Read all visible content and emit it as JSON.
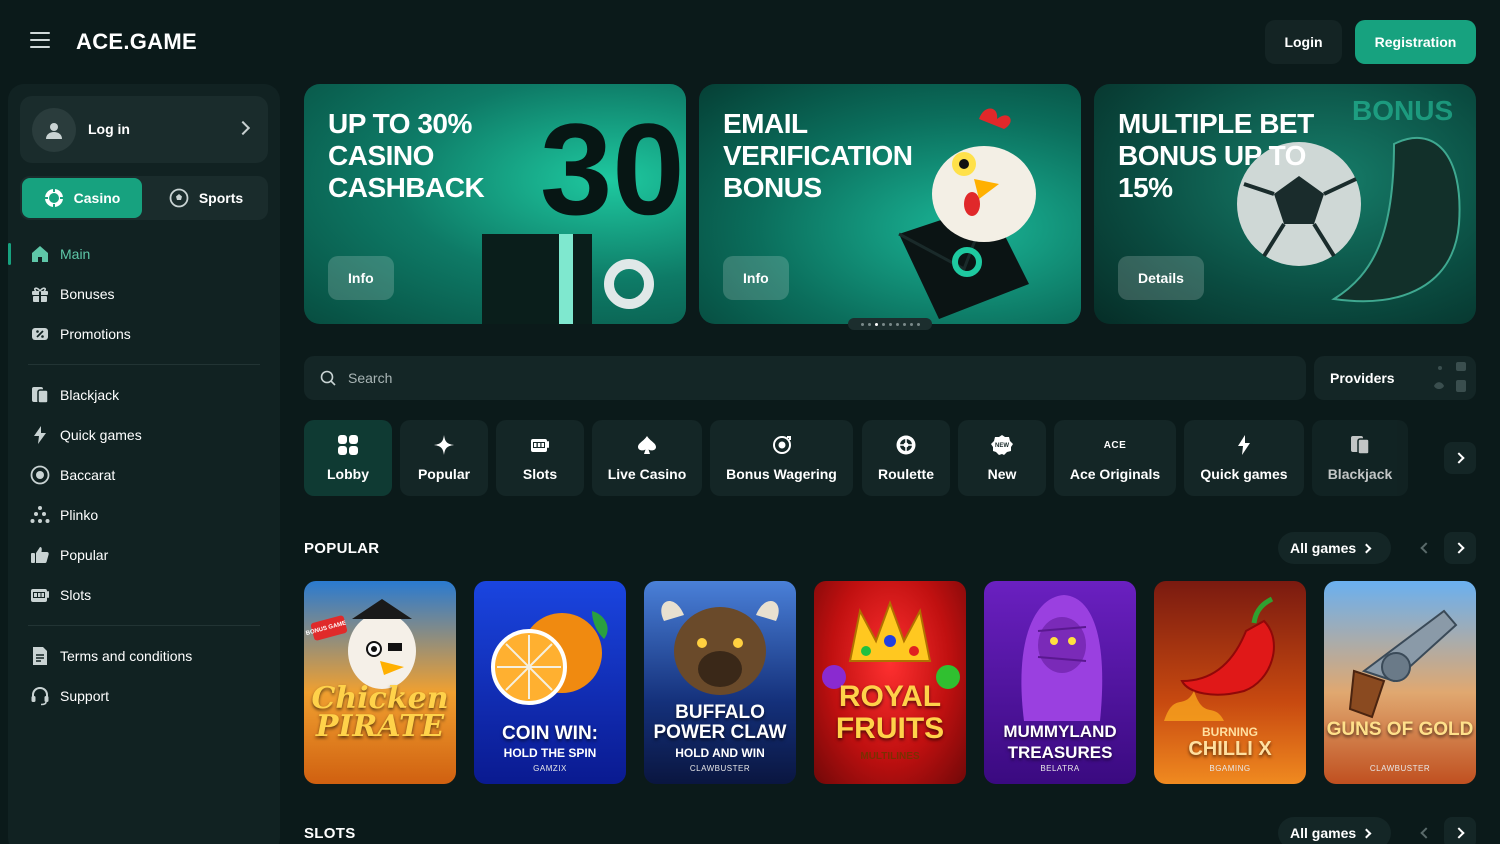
{
  "header": {
    "logo": "ACE.GAME",
    "login_label": "Login",
    "registration_label": "Registration"
  },
  "sidebar": {
    "login_card_label": "Log in",
    "switch": {
      "casino": "Casino",
      "sports": "Sports"
    },
    "main_nav": [
      {
        "label": "Main",
        "icon": "home-icon",
        "active": true
      },
      {
        "label": "Bonuses",
        "icon": "gift-icon"
      },
      {
        "label": "Promotions",
        "icon": "ticket-icon"
      }
    ],
    "game_nav": [
      {
        "label": "Blackjack",
        "icon": "cards-icon"
      },
      {
        "label": "Quick games",
        "icon": "lightning-icon"
      },
      {
        "label": "Baccarat",
        "icon": "chip-icon"
      },
      {
        "label": "Plinko",
        "icon": "plinko-icon"
      },
      {
        "label": "Popular",
        "icon": "thumbs-up-icon"
      },
      {
        "label": "Slots",
        "icon": "slot-machine-icon"
      }
    ],
    "footer_nav": [
      {
        "label": "Terms and conditions",
        "icon": "document-icon"
      },
      {
        "label": "Support",
        "icon": "headset-icon"
      }
    ]
  },
  "banners": [
    {
      "title": "UP TO 30% CASINO CASHBACK",
      "button": "Info",
      "deco": "30"
    },
    {
      "title": "EMAIL VERIFICATION BONUS",
      "button": "Info"
    },
    {
      "title": "MULTIPLE BET BONUS UP TO 15%",
      "button": "Details",
      "deco": "BONUS"
    }
  ],
  "carousel": {
    "count": 9,
    "active": 2
  },
  "search": {
    "placeholder": "Search"
  },
  "providers_label": "Providers",
  "categories": [
    {
      "label": "Lobby",
      "icon": "grid-icon",
      "active": true
    },
    {
      "label": "Popular",
      "icon": "sparkle-icon"
    },
    {
      "label": "Slots",
      "icon": "slot-machine-icon"
    },
    {
      "label": "Live Casino",
      "icon": "spade-icon"
    },
    {
      "label": "Bonus Wagering",
      "icon": "wager-icon"
    },
    {
      "label": "Roulette",
      "icon": "roulette-icon"
    },
    {
      "label": "New",
      "icon": "new-badge-icon",
      "icon_text": "NEW"
    },
    {
      "label": "Ace Originals",
      "icon": "ace-icon",
      "icon_text": "ACE"
    },
    {
      "label": "Quick games",
      "icon": "lightning-icon"
    },
    {
      "label": "Blackjack",
      "icon": "cards-icon"
    }
  ],
  "sections": [
    {
      "title": "POPULAR",
      "all_label": "All games"
    },
    {
      "title": "SLOTS",
      "all_label": "All games"
    }
  ],
  "games": [
    {
      "title": "Chicken PIRATE",
      "badge": "BONUS GAME",
      "colors": [
        "#1a5fb0",
        "#f0a030"
      ]
    },
    {
      "title": "COIN WIN:",
      "subtitle": "HOLD THE SPIN",
      "provider": "GAMZIX",
      "colors": [
        "#1235c8",
        "#0a1a6a"
      ]
    },
    {
      "title": "BUFFALO POWER CLAW",
      "subtitle": "HOLD AND WIN",
      "provider": "CLAWBUSTER",
      "colors": [
        "#3a70c8",
        "#0f2050"
      ]
    },
    {
      "title": "ROYAL FRUITS",
      "subtitle": "MULTILINES",
      "colors": [
        "#e01a1a",
        "#7a0808"
      ]
    },
    {
      "title": "MUMMYLAND TREASURES",
      "provider": "BELATRA",
      "colors": [
        "#5a20b0",
        "#2a0a50"
      ]
    },
    {
      "title": "BURNING",
      "subtitle": "CHILLI X",
      "provider": "BGAMING",
      "colors": [
        "#b83a10",
        "#f08020"
      ]
    },
    {
      "title": "GUNS OF GOLD",
      "provider": "CLAWBUSTER",
      "colors": [
        "#5aa0e8",
        "#e07030"
      ]
    }
  ],
  "colors": {
    "accent": "#17a27f",
    "background": "#0b1a1a",
    "panel": "#112222",
    "chip": "#142626"
  }
}
